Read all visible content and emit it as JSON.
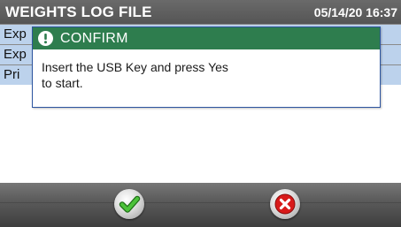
{
  "header": {
    "title": "WEIGHTS LOG FILE",
    "datetime": "05/14/20 16:37"
  },
  "list": {
    "items": [
      {
        "label": "Exp"
      },
      {
        "label": "Exp"
      },
      {
        "label": "Pri"
      }
    ]
  },
  "dialog": {
    "title": "CONFIRM",
    "icon": "alert-icon",
    "message_line1": "Insert the USB Key and press Yes",
    "message_line2": "to start."
  },
  "footer": {
    "yes_icon": "checkmark-icon",
    "no_icon": "x-icon"
  },
  "colors": {
    "header_bg": "#5e5e5e",
    "list_row_bg": "#bcd2ec",
    "dialog_titlebar": "#2e7d4e",
    "dialog_border": "#2d55a0",
    "yes_green": "#3aa82c",
    "no_red": "#d81a1a"
  }
}
